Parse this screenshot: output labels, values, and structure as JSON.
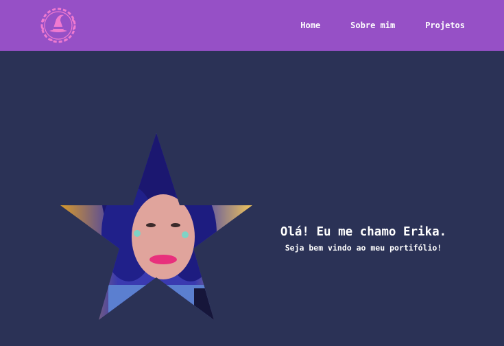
{
  "nav": {
    "logo_icon": "witch-hat-wreath-icon",
    "links": [
      {
        "label": "Home"
      },
      {
        "label": "Sobre mim"
      },
      {
        "label": "Projetos"
      }
    ]
  },
  "hero": {
    "title": "Olá! Eu me chamo Erika.",
    "subtitle": "Seja bem vindo ao meu portifólio!",
    "photo_icon": "star-portrait-photo"
  },
  "colors": {
    "navbar": "#9650c6",
    "background": "#2b3256",
    "logo": "#f07ad0",
    "text": "#ffffff"
  }
}
